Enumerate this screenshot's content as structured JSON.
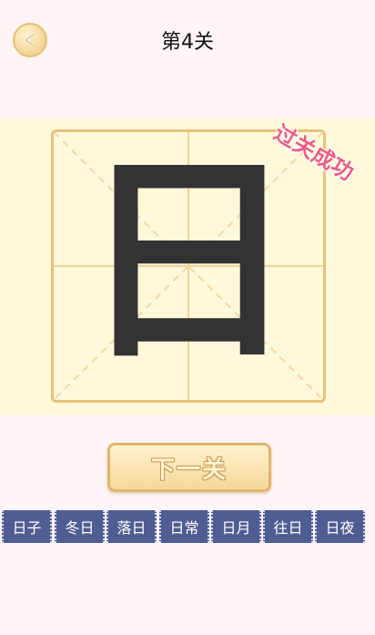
{
  "header": {
    "title": "第4关",
    "back_icon": "back-arrow-icon"
  },
  "board": {
    "character": "日",
    "stamp": "过关成功"
  },
  "next_button": {
    "label": "下一关"
  },
  "words": [
    "日子",
    "冬日",
    "落日",
    "日常",
    "日月",
    "往日",
    "日夜"
  ],
  "colors": {
    "background": "#fff5f7",
    "board_background": "#fff8da",
    "grid_border": "#e8c27b",
    "stamp": "#ec5f80",
    "word_tile": "#4f5d93"
  }
}
